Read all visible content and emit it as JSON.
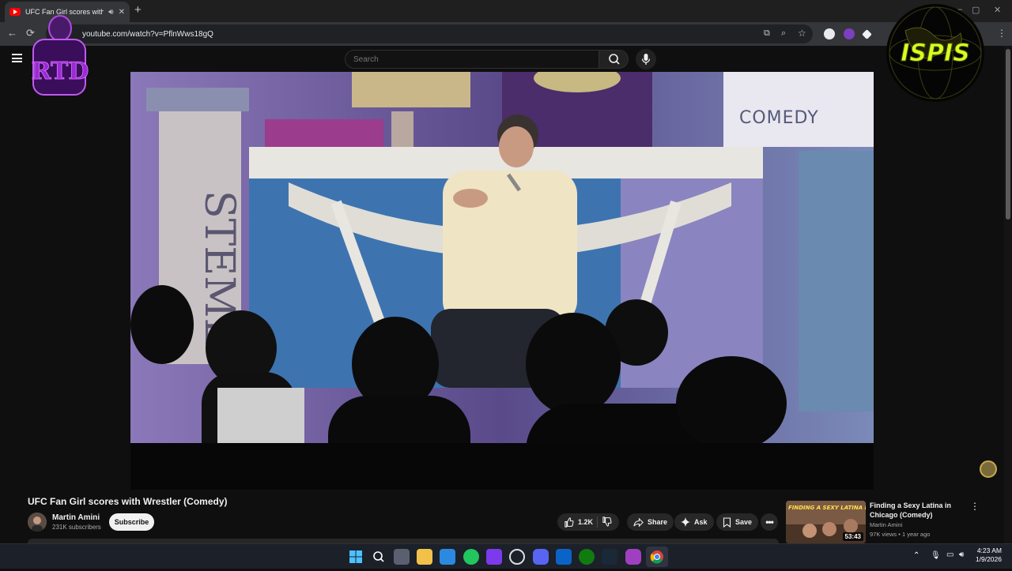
{
  "browser": {
    "tab_title": "UFC Fan Girl scores with Wrestler (Comedy)",
    "new_tab": "+",
    "url": "youtube.com/watch?v=PflnWws18gQ"
  },
  "header": {
    "search_placeholder": "Search"
  },
  "video": {
    "title": "UFC Fan Girl scores with Wrestler (Comedy)",
    "channel": "Martin Amini",
    "subscribers": "231K subscribers",
    "subscribe_label": "Subscribe",
    "likes": "1.2K",
    "share_label": "Share",
    "ask_label": "Ask",
    "save_label": "Save"
  },
  "recommendation": {
    "title": "Finding a Sexy Latina in Chicago (Comedy)",
    "channel": "Martin Amini",
    "meta": "97K views • 1 year ago",
    "duration": "53:43",
    "thumb_text": "FINDING A SEXY LATINA IN CHICAGO"
  },
  "overlays": {
    "left_logo_text": "RTD",
    "right_logo_text": "ISPIS"
  },
  "taskbar": {
    "time": "4:23 AM",
    "date": "1/9/2026"
  },
  "colors": {
    "youtube_red": "#ff0000",
    "background": "#0f0f0f",
    "pill": "#272727",
    "taskbar": "#1c2029"
  }
}
